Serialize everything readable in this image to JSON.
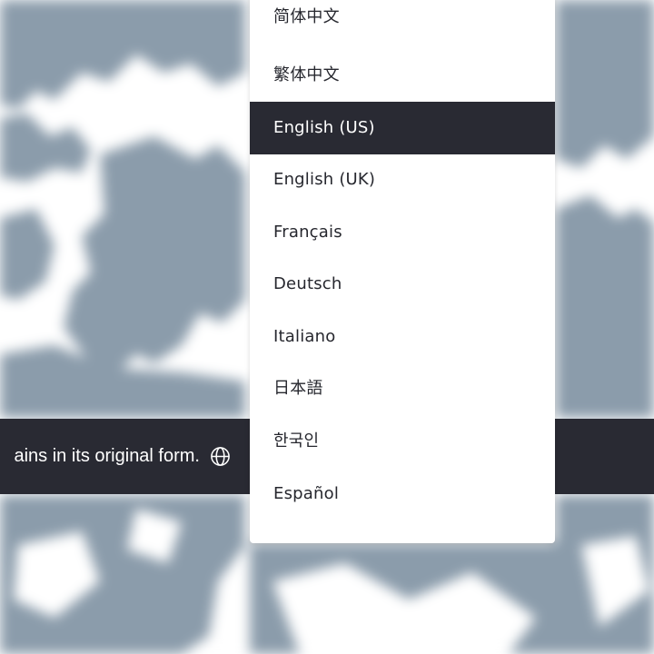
{
  "notice": {
    "text": "ains in its original form."
  },
  "icons": {
    "language": "globe-icon"
  },
  "language_menu": {
    "selected": "English (US)",
    "items": [
      {
        "label": "简体中文",
        "selected": false
      },
      {
        "label": "繁体中文",
        "selected": false
      },
      {
        "label": "English (US)",
        "selected": true
      },
      {
        "label": "English (UK)",
        "selected": false
      },
      {
        "label": "Français",
        "selected": false
      },
      {
        "label": "Deutsch",
        "selected": false
      },
      {
        "label": "Italiano",
        "selected": false
      },
      {
        "label": "日本語",
        "selected": false
      },
      {
        "label": "한국인",
        "selected": false
      },
      {
        "label": "Español",
        "selected": false
      }
    ]
  },
  "colors": {
    "map_water": "#ffffff",
    "map_land": "#8b9cab",
    "dark_bar": "#292a33",
    "menu_bg": "#ffffff",
    "selected_bg": "#292a33"
  }
}
